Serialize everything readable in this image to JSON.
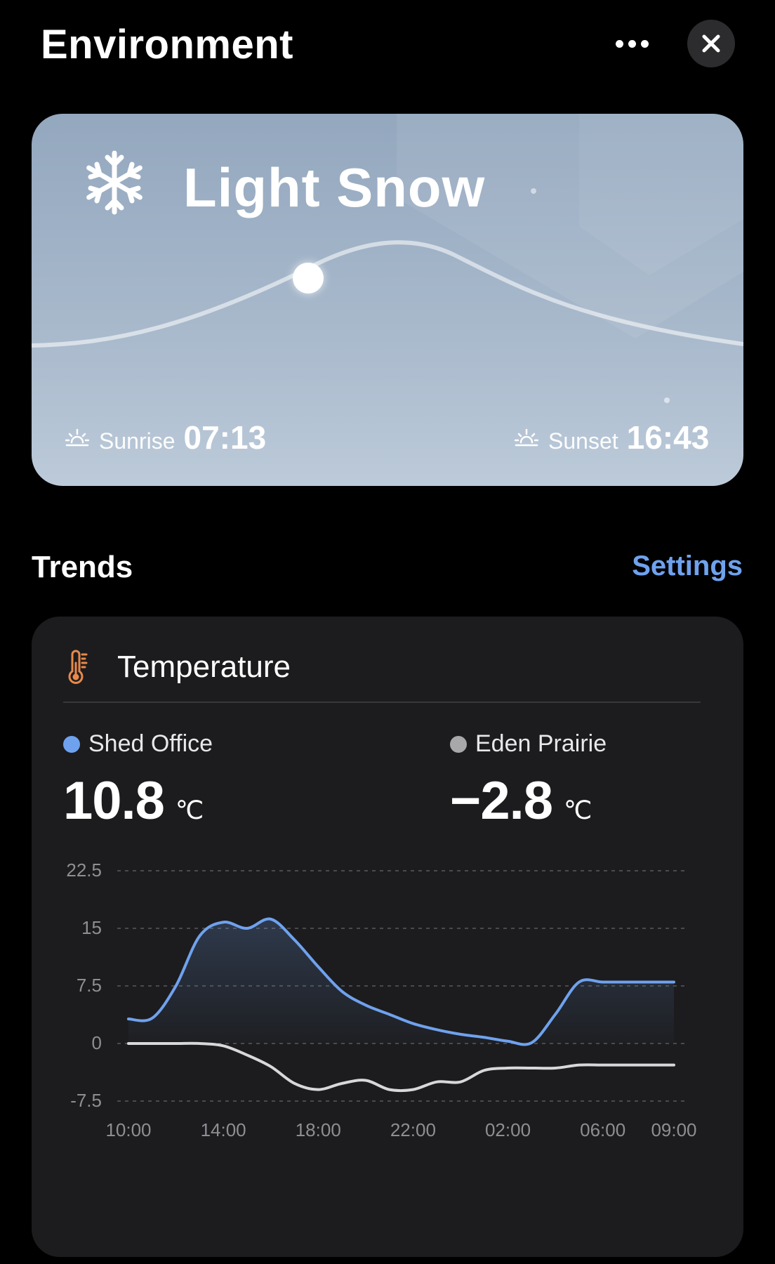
{
  "header": {
    "title": "Environment",
    "more_icon": "more-horizontal-icon",
    "close_icon": "close-icon"
  },
  "weather": {
    "condition": "Light Snow",
    "icon": "snowflake-icon",
    "sunrise_label": "Sunrise",
    "sunrise_time": "07:13",
    "sunset_label": "Sunset",
    "sunset_time": "16:43"
  },
  "trends": {
    "title": "Trends",
    "settings_label": "Settings"
  },
  "temperature": {
    "title": "Temperature",
    "icon": "thermometer-icon",
    "readings": [
      {
        "name": "Shed Office",
        "value": "10.8",
        "unit": "℃",
        "color": "#6fa2ee"
      },
      {
        "name": "Eden Prairie",
        "value": "−2.8",
        "unit": "℃",
        "color": "#a8a8aa"
      }
    ]
  },
  "chart_data": {
    "type": "line",
    "x": [
      "10:00",
      "11:00",
      "12:00",
      "13:00",
      "14:00",
      "15:00",
      "16:00",
      "17:00",
      "18:00",
      "19:00",
      "20:00",
      "21:00",
      "22:00",
      "23:00",
      "00:00",
      "01:00",
      "02:00",
      "03:00",
      "04:00",
      "05:00",
      "06:00",
      "07:00",
      "08:00",
      "09:00"
    ],
    "x_ticks": [
      "10:00",
      "14:00",
      "18:00",
      "22:00",
      "02:00",
      "06:00",
      "09:00"
    ],
    "y_ticks": [
      "22.5",
      "15",
      "7.5",
      "0",
      "-7.5"
    ],
    "ylim": [
      -7.5,
      22.5
    ],
    "grid": true,
    "series": [
      {
        "name": "Shed Office",
        "color": "#6fa2ee",
        "values": [
          3.2,
          3.3,
          7.5,
          14.0,
          15.8,
          15.0,
          16.2,
          13.5,
          10.0,
          6.8,
          5.0,
          3.8,
          2.6,
          1.8,
          1.2,
          0.8,
          0.3,
          0.1,
          3.8,
          8.0,
          8.0,
          8.0,
          8.0,
          8.0
        ]
      },
      {
        "name": "Eden Prairie",
        "color": "#d8d8da",
        "values": [
          0.0,
          0.0,
          0.0,
          0.0,
          -0.3,
          -1.5,
          -3.0,
          -5.2,
          -6.0,
          -5.2,
          -4.8,
          -6.0,
          -6.0,
          -5.0,
          -5.0,
          -3.5,
          -3.2,
          -3.2,
          -3.2,
          -2.8,
          -2.8,
          -2.8,
          -2.8,
          -2.8
        ]
      }
    ]
  }
}
